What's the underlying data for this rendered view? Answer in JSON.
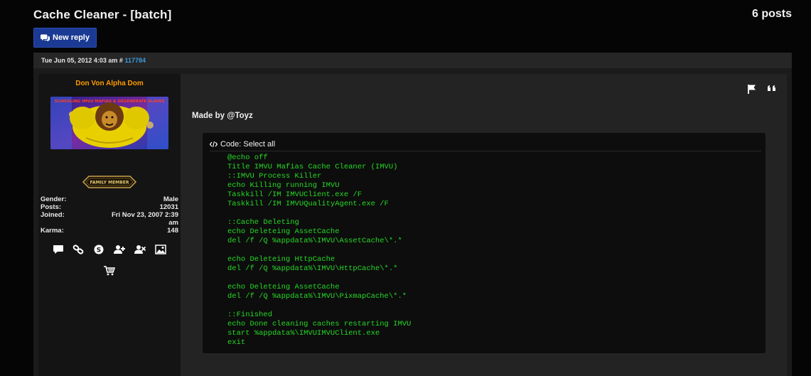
{
  "topic": {
    "title": "Cache Cleaner - [batch]",
    "post_count": "6 posts"
  },
  "buttons": {
    "new_reply": "New reply"
  },
  "post": {
    "date": "Tue Jun 05, 2012 4:03 am",
    "hash": "#",
    "id": "117784",
    "author": {
      "username": "Don Von Alpha Dom",
      "username_color": "#ff9c00",
      "avatar_caption": "SCHOOLING IMVU MAFIAS & DEGENERATE SLAVES",
      "rank_label": "FAMILY MEMBER",
      "fields": [
        {
          "label": "Gender:",
          "value": "Male"
        },
        {
          "label": "Posts:",
          "value": "12031"
        },
        {
          "label": "Joined:",
          "value": "Fri Nov 23, 2007 2:39 am"
        },
        {
          "label": "Karma:",
          "value": "148"
        }
      ],
      "contact_icons": [
        "speech-bubble-icon",
        "link-icon",
        "skype-icon",
        "add-friend-icon",
        "remove-friend-icon",
        "image-icon",
        "shopping-cart-icon"
      ]
    },
    "action_icons": [
      "flag-icon",
      "quote-icon"
    ],
    "text": "Made by @Toyz",
    "code": {
      "header": "Code: Select all",
      "lines": [
        "@echo off",
        "Title IMVU Mafias Cache Cleaner (IMVU)",
        "::IMVU Process Killer",
        "echo Killing running IMVU",
        "Taskkill /IM IMVUClient.exe /F",
        "Taskkill /IM IMVUQualityAgent.exe /F",
        "",
        "::Cache Deleting",
        "echo Deleteing AssetCache",
        "del /f /Q %appdata%\\IMVU\\AssetCache\\*.*",
        "",
        "echo Deleteing HttpCache",
        "del /f /Q %appdata%\\IMVU\\HttpCache\\*.*",
        "",
        "echo Deleteing AssetCache",
        "del /f /Q %appdata%\\IMVU\\PixmapCache\\*.*",
        "",
        "::Finished",
        "echo Done cleaning caches restarting IMVU",
        "start %appdata%\\IMVUIMVUClient.exe",
        "exit"
      ]
    }
  },
  "colors": {
    "background": "#050505",
    "panel": "#232323",
    "profile_panel": "#141414",
    "button": "#1a3a94",
    "link": "#3a9be0",
    "code_text": "#26d926"
  }
}
